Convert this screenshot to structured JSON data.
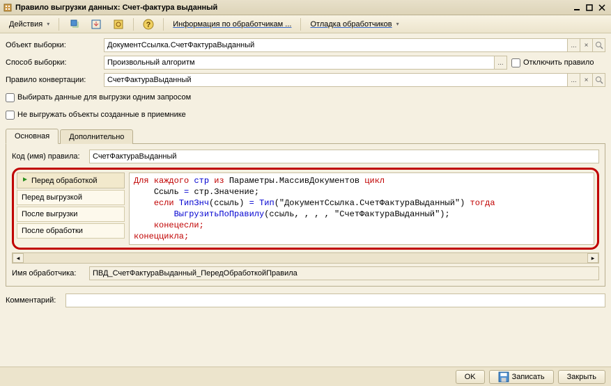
{
  "window": {
    "title": "Правило выгрузки данных: Счет-фактура выданный"
  },
  "toolbar": {
    "actions_label": "Действия",
    "info_label": "Информация по обработчикам ...",
    "debug_label": "Отладка обработчиков"
  },
  "form": {
    "object_label": "Объект выборки:",
    "object_value": "ДокументСсылка.СчетФактураВыданный",
    "method_label": "Способ выборки:",
    "method_value": "Произвольный алгоритм",
    "disable_rule_label": "Отключить правило",
    "convert_rule_label": "Правило конвертации:",
    "convert_rule_value": "СчетФактураВыданный",
    "select_single_query": "Выбирать данные для выгрузки одним запросом",
    "dont_export_created": "Не выгружать объекты созданные в приемнике"
  },
  "tabs": {
    "main": "Основная",
    "additional": "Дополнительно"
  },
  "rule": {
    "code_label": "Код (имя) правила:",
    "code_value": "СчетФактураВыданный"
  },
  "events": {
    "before_processing": "Перед обработкой",
    "before_export": "Перед выгрузкой",
    "after_export": "После выгрузки",
    "after_processing": "После обработки"
  },
  "code": {
    "l1_kw1": "Для",
    "l1_kw2": "каждого",
    "l1_var": "стр",
    "l1_kw3": "из",
    "l1_expr": "Параметры.МассивДокументов",
    "l1_kw4": "цикл",
    "l2_lhs": "Ссыль",
    "l2_eq": "=",
    "l2_rhs": "стр.Значение;",
    "l3_kw": "если",
    "l3_fn1": "ТипЗнч",
    "l3_arg1": "(ссыль)",
    "l3_eq": "=",
    "l3_fn2": "Тип",
    "l3_arg2": "(\"ДокументСсылка.СчетФактураВыданный\")",
    "l3_kw2": "тогда",
    "l4_fn": "ВыгрузитьПоПравилу",
    "l4_args": "(ссыль, , , , \"СчетФактураВыданный\");",
    "l5_kw": "конецесли;",
    "l6_kw": "конеццикла;"
  },
  "handler": {
    "label": "Имя обработчика:",
    "value": "ПВД_СчетФактураВыданный_ПередОбработкойПравила"
  },
  "comment": {
    "label": "Комментарий:",
    "value": ""
  },
  "footer": {
    "ok": "OK",
    "save": "Записать",
    "close": "Закрыть"
  }
}
